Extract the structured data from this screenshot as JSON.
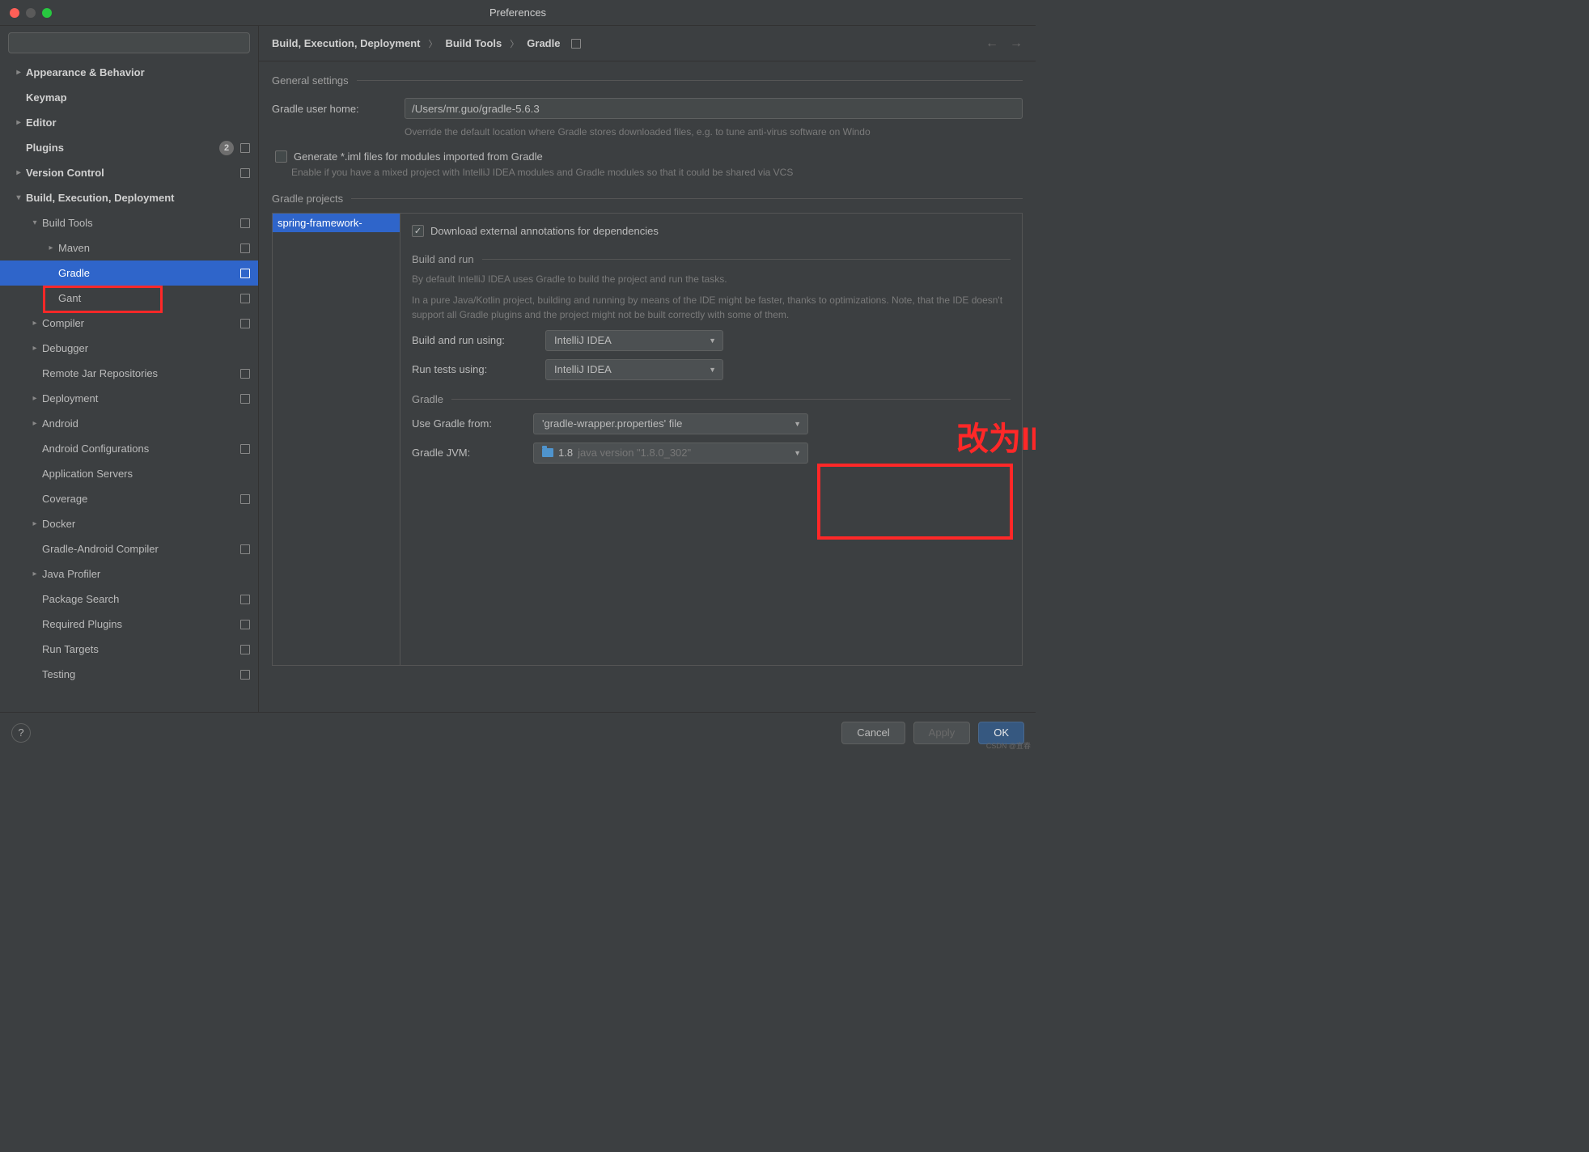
{
  "window": {
    "title": "Preferences"
  },
  "breadcrumb": {
    "a": "Build, Execution, Deployment",
    "b": "Build Tools",
    "c": "Gradle"
  },
  "search": {
    "placeholder": ""
  },
  "sidebar": {
    "items": [
      {
        "label": "Appearance & Behavior",
        "bold": true,
        "chev": "right",
        "indent": 0
      },
      {
        "label": "Keymap",
        "bold": true,
        "indent": 0
      },
      {
        "label": "Editor",
        "bold": true,
        "chev": "right",
        "indent": 0
      },
      {
        "label": "Plugins",
        "bold": true,
        "indent": 0,
        "count": "2",
        "proj": true
      },
      {
        "label": "Version Control",
        "bold": true,
        "chev": "right",
        "indent": 0,
        "proj": true
      },
      {
        "label": "Build, Execution, Deployment",
        "bold": true,
        "chev": "down",
        "indent": 0
      },
      {
        "label": "Build Tools",
        "chev": "down",
        "indent": 1,
        "proj": true
      },
      {
        "label": "Maven",
        "chev": "right",
        "indent": 2,
        "proj": true
      },
      {
        "label": "Gradle",
        "indent": 2,
        "selected": true,
        "proj": true
      },
      {
        "label": "Gant",
        "indent": 2,
        "proj": true
      },
      {
        "label": "Compiler",
        "chev": "right",
        "indent": 1,
        "proj": true
      },
      {
        "label": "Debugger",
        "chev": "right",
        "indent": 1
      },
      {
        "label": "Remote Jar Repositories",
        "indent": 1,
        "proj": true
      },
      {
        "label": "Deployment",
        "chev": "right",
        "indent": 1,
        "proj": true
      },
      {
        "label": "Android",
        "chev": "right",
        "indent": 1
      },
      {
        "label": "Android Configurations",
        "indent": 1,
        "proj": true
      },
      {
        "label": "Application Servers",
        "indent": 1
      },
      {
        "label": "Coverage",
        "indent": 1,
        "proj": true
      },
      {
        "label": "Docker",
        "chev": "right",
        "indent": 1
      },
      {
        "label": "Gradle-Android Compiler",
        "indent": 1,
        "proj": true
      },
      {
        "label": "Java Profiler",
        "chev": "right",
        "indent": 1
      },
      {
        "label": "Package Search",
        "indent": 1,
        "proj": true
      },
      {
        "label": "Required Plugins",
        "indent": 1,
        "proj": true
      },
      {
        "label": "Run Targets",
        "indent": 1,
        "proj": true
      },
      {
        "label": "Testing",
        "indent": 1,
        "proj": true
      }
    ]
  },
  "general": {
    "title": "General settings",
    "home_label": "Gradle user home:",
    "home_value": "/Users/mr.guo/gradle-5.6.3",
    "home_hint": "Override the default location where Gradle stores downloaded files, e.g. to tune anti-virus software on Windo",
    "gen_iml_label": "Generate *.iml files for modules imported from Gradle",
    "gen_iml_hint": "Enable if you have a mixed project with IntelliJ IDEA modules and Gradle modules so that it could be shared via VCS"
  },
  "projects": {
    "title": "Gradle projects",
    "list": [
      "spring-framework-"
    ],
    "download_label": "Download external annotations for dependencies",
    "build_run": {
      "title": "Build and run",
      "desc1": "By default IntelliJ IDEA uses Gradle to build the project and run the tasks.",
      "desc2": "In a pure Java/Kotlin project, building and running by means of the IDE might be faster, thanks to optimizations. Note, that the IDE doesn't support all Gradle plugins and the project might not be built correctly with some of them.",
      "build_label": "Build and run using:",
      "build_value": "IntelliJ IDEA",
      "tests_label": "Run tests using:",
      "tests_value": "IntelliJ IDEA"
    },
    "gradle": {
      "title": "Gradle",
      "from_label": "Use Gradle from:",
      "from_value": "'gradle-wrapper.properties' file",
      "jvm_label": "Gradle JVM:",
      "jvm_ver": "1.8",
      "jvm_sub": "java version \"1.8.0_302\""
    }
  },
  "annotation": "改为IDEA",
  "footer": {
    "cancel": "Cancel",
    "apply": "Apply",
    "ok": "OK"
  },
  "watermark": "CSDN @宜春"
}
